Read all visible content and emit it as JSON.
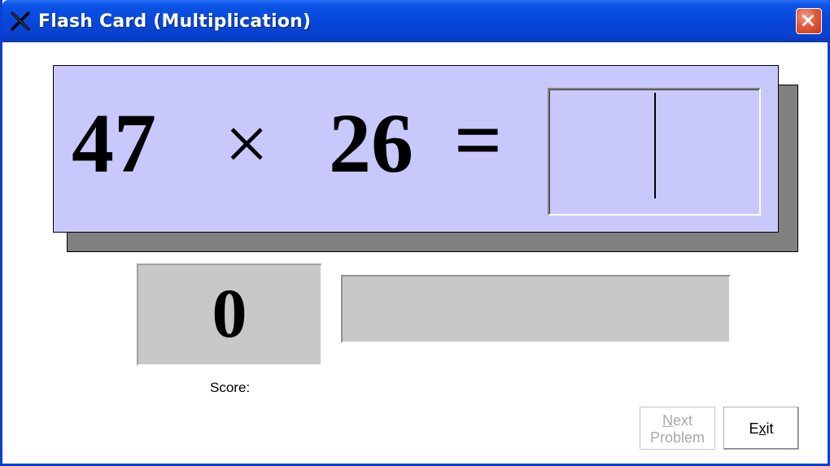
{
  "window": {
    "title": "Flash Card (Multiplication)",
    "icon": "multiply-x-icon",
    "close_icon": "close-icon"
  },
  "problem": {
    "operand_a": "47",
    "operator": "×",
    "operand_b": "26",
    "equals": "=",
    "answer_value": ""
  },
  "score": {
    "value": "0",
    "label": "Score:"
  },
  "feedback": {
    "text": ""
  },
  "buttons": {
    "next": {
      "mnemonic": "N",
      "line1_rest": "ext",
      "line2": "Problem",
      "enabled": false
    },
    "exit": {
      "before": "E",
      "mnemonic": "x",
      "after": "it"
    }
  },
  "colors": {
    "title_bar": "#0846d8",
    "card": "#c8c8fc",
    "card_shadow": "#808080",
    "panel": "#c8c8c8",
    "close_button": "#e15a3a"
  }
}
